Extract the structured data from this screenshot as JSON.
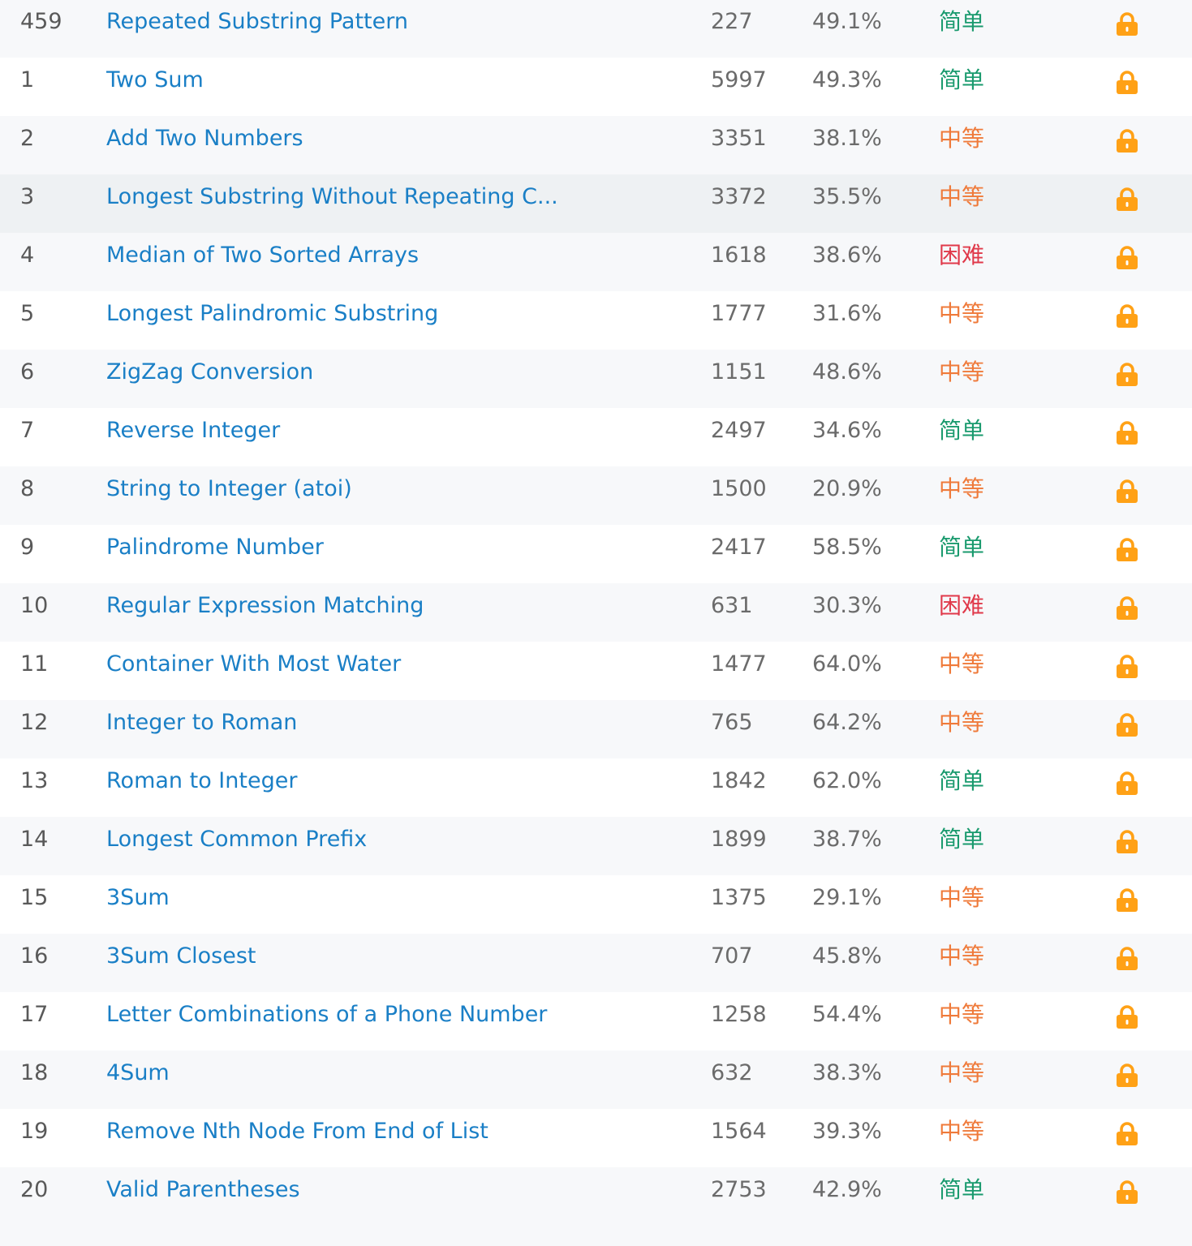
{
  "colors": {
    "easy": "#1a9a6e",
    "medium": "#ef7a3a",
    "hard": "#e0394a",
    "title_link": "#1a7fc6",
    "lock": "#ffa116"
  },
  "problems": [
    {
      "id": "459",
      "title": "Repeated Substring Pattern",
      "solutions": "227",
      "acceptance": "49.1%",
      "difficulty": "简单",
      "level": "easy",
      "locked": true
    },
    {
      "id": "1",
      "title": "Two Sum",
      "solutions": "5997",
      "acceptance": "49.3%",
      "difficulty": "简单",
      "level": "easy",
      "locked": true
    },
    {
      "id": "2",
      "title": "Add Two Numbers",
      "solutions": "3351",
      "acceptance": "38.1%",
      "difficulty": "中等",
      "level": "medium",
      "locked": true
    },
    {
      "id": "3",
      "title": "Longest Substring Without Repeating C...",
      "solutions": "3372",
      "acceptance": "35.5%",
      "difficulty": "中等",
      "level": "medium",
      "locked": true
    },
    {
      "id": "4",
      "title": "Median of Two Sorted Arrays",
      "solutions": "1618",
      "acceptance": "38.6%",
      "difficulty": "困难",
      "level": "hard",
      "locked": true
    },
    {
      "id": "5",
      "title": "Longest Palindromic Substring",
      "solutions": "1777",
      "acceptance": "31.6%",
      "difficulty": "中等",
      "level": "medium",
      "locked": true
    },
    {
      "id": "6",
      "title": "ZigZag Conversion",
      "solutions": "1151",
      "acceptance": "48.6%",
      "difficulty": "中等",
      "level": "medium",
      "locked": true
    },
    {
      "id": "7",
      "title": "Reverse Integer",
      "solutions": "2497",
      "acceptance": "34.6%",
      "difficulty": "简单",
      "level": "easy",
      "locked": true
    },
    {
      "id": "8",
      "title": "String to Integer (atoi)",
      "solutions": "1500",
      "acceptance": "20.9%",
      "difficulty": "中等",
      "level": "medium",
      "locked": true
    },
    {
      "id": "9",
      "title": "Palindrome Number",
      "solutions": "2417",
      "acceptance": "58.5%",
      "difficulty": "简单",
      "level": "easy",
      "locked": true
    },
    {
      "id": "10",
      "title": "Regular Expression Matching",
      "solutions": "631",
      "acceptance": "30.3%",
      "difficulty": "困难",
      "level": "hard",
      "locked": true
    },
    {
      "id": "11",
      "title": "Container With Most Water",
      "solutions": "1477",
      "acceptance": "64.0%",
      "difficulty": "中等",
      "level": "medium",
      "locked": true
    },
    {
      "id": "12",
      "title": "Integer to Roman",
      "solutions": "765",
      "acceptance": "64.2%",
      "difficulty": "中等",
      "level": "medium",
      "locked": true
    },
    {
      "id": "13",
      "title": "Roman to Integer",
      "solutions": "1842",
      "acceptance": "62.0%",
      "difficulty": "简单",
      "level": "easy",
      "locked": true
    },
    {
      "id": "14",
      "title": "Longest Common Prefix",
      "solutions": "1899",
      "acceptance": "38.7%",
      "difficulty": "简单",
      "level": "easy",
      "locked": true
    },
    {
      "id": "15",
      "title": "3Sum",
      "solutions": "1375",
      "acceptance": "29.1%",
      "difficulty": "中等",
      "level": "medium",
      "locked": true
    },
    {
      "id": "16",
      "title": "3Sum Closest",
      "solutions": "707",
      "acceptance": "45.8%",
      "difficulty": "中等",
      "level": "medium",
      "locked": true
    },
    {
      "id": "17",
      "title": "Letter Combinations of a Phone Number",
      "solutions": "1258",
      "acceptance": "54.4%",
      "difficulty": "中等",
      "level": "medium",
      "locked": true
    },
    {
      "id": "18",
      "title": "4Sum",
      "solutions": "632",
      "acceptance": "38.3%",
      "difficulty": "中等",
      "level": "medium",
      "locked": true
    },
    {
      "id": "19",
      "title": "Remove Nth Node From End of List",
      "solutions": "1564",
      "acceptance": "39.3%",
      "difficulty": "中等",
      "level": "medium",
      "locked": true
    },
    {
      "id": "20",
      "title": "Valid Parentheses",
      "solutions": "2753",
      "acceptance": "42.9%",
      "difficulty": "简单",
      "level": "easy",
      "locked": true
    }
  ]
}
